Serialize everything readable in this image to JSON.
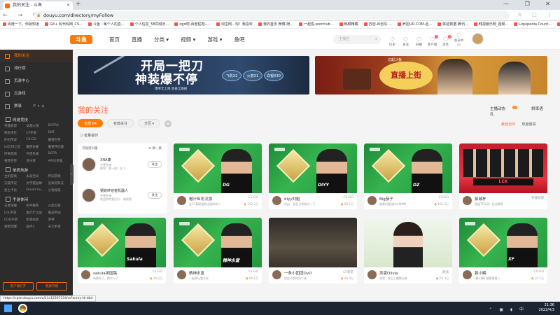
{
  "browser": {
    "tab_title": "我的关注 - 斗鱼",
    "url": "douyu.com/directory/myFollow",
    "bookmarks": [
      "百度一下，你就知道",
      "Git+ 码代码网_CS...",
      "斗鱼 - 每个人的直...",
      "个人信息_58同城手...",
      "ogd吧-百度贴吧--...",
      "淘宝网 - 淘！我喜欢",
      "我的首页 微博-随...",
      "一起看-pornhub...",
      "韩颖精确",
      "苏创-AI创写-...",
      "养招UD.COM-足...",
      "体验数据-腾讯...",
      "韩视最乐网_视频...",
      "Liquipedia Count...",
      "维强网后台"
    ]
  },
  "header": {
    "logo": "斗鱼",
    "nav": [
      "首页",
      "直播",
      "分类",
      "视频",
      "游戏",
      "鱼吧"
    ],
    "search_placeholder": "主播名",
    "tools": [
      {
        "label": "历史",
        "icon": "history-icon",
        "badge": ""
      },
      {
        "label": "关注",
        "icon": "heart-icon",
        "badge": ""
      },
      {
        "label": "开播",
        "icon": "camera-icon",
        "badge": ""
      },
      {
        "label": "客户端",
        "icon": "download-icon",
        "badge": "9"
      },
      {
        "label": "消息",
        "icon": "bell-icon",
        "badge": "6"
      },
      {
        "label": "会员中心",
        "icon": "vip-icon",
        "badge": ""
      }
    ]
  },
  "sidebar": {
    "items": [
      {
        "label": "我的关注",
        "active": true
      },
      {
        "label": "排行榜",
        "active": false
      },
      {
        "label": "页游中心",
        "active": false
      },
      {
        "label": "云游戏",
        "active": false
      }
    ],
    "icon_row": "赛事",
    "sections": [
      {
        "title": "网游竞技",
        "items": [
          "英雄联盟",
          "穿越火线",
          "DOTA2",
          "绝地求生",
          "CF手游",
          "DNF",
          "炉石传说",
          "CS:GO",
          "魔兽世界",
          "lol云顶之弈",
          "魔兽争霸",
          "魔兽怀旧服",
          "传奇游戏",
          "守望先锋",
          "DOTA",
          "重燃世界",
          "逆水寒",
          "APEX英雄"
        ]
      },
      {
        "title": "单机热游",
        "items": [
          "主机游戏",
          "永劫无间",
          "怀旧游戏",
          "天痕传说",
          "文字盟运球",
          "逃离塔科夫",
          "星之卡比",
          "Dread Hu...",
          "小程呱呱"
        ]
      },
      {
        "title": "手游休闲",
        "items": [
          "王者荣耀",
          "和平精英",
          "火影忍者",
          "LOL手游",
          "金铲铲之战",
          "重返帝国",
          "COD手游",
          "新游拟放",
          "原神",
          "黎明觉醒",
          "崩坏3",
          "天刀手游"
        ]
      }
    ],
    "btn_client": "客户端打开",
    "btn_live": "我要开播"
  },
  "banners": {
    "b1_slogan1": "开局一把刀",
    "b1_slogan2": "神装爆不停",
    "b1_sub": "爆率无上限 装备全靠刷",
    "b1_badges": [
      "飞机X2",
      "火箭X1",
      "白银X30"
    ],
    "b2_title": "直播上街",
    "b2_pretitle": "亿起斗鱼"
  },
  "follow": {
    "title": "我的关注",
    "actions": [
      {
        "label": "主播动态",
        "badge": "27"
      },
      {
        "label": "斜率语孔",
        "badge": ""
      }
    ],
    "filters": [
      {
        "label": "全部",
        "count": "64",
        "on": true
      },
      {
        "label": "有鼓关注",
        "count": "",
        "on": false
      },
      {
        "label": "分区",
        "count": "",
        "on": false
      }
    ],
    "sort_hot": "最佳访问",
    "sort_new": "热度最高",
    "batch": "批量操作"
  },
  "recommend": {
    "header": "可能感兴趣",
    "switch": "换一换",
    "items": [
      {
        "name": "XNA康",
        "desc1": "守望先锋",
        "desc2": "聊到：我一起 [ 在 ]",
        "follow": "关注"
      },
      {
        "name": "钢铁终结者机器人",
        "desc1": "守望先锋",
        "desc2": "欢迎你的我们为... 继续吧",
        "follow": "关注"
      }
    ]
  },
  "cards": [
    {
      "name": "帽汁纵冬汉强",
      "game": "CS:GO",
      "title": "全CF基础强的出现的男人",
      "views": "152.2万",
      "plate": "DG"
    },
    {
      "name": "diyy刘姐",
      "game": "CS:GO",
      "title": "diyy：钻石大家助力一下",
      "views": "60.1万",
      "plate": "DIYY"
    },
    {
      "name": "Big茄子",
      "game": "CS:GO",
      "title": "能赛对窗组tha M4f8",
      "views": "101.5万",
      "plate": "DZ"
    },
    {
      "name": "拓城杯",
      "game": "英雄联盟",
      "title": "首届TT年冠：拉法赛等",
      "views": "",
      "plate": ""
    },
    {
      "name": "sakula英国路",
      "game": "CS:GO",
      "title": "新赛车了，斯中十了",
      "views": "35.2万",
      "plate": "Sakula"
    },
    {
      "name": "精神永富",
      "game": "CS:GO",
      "title": "一起来玩看大家",
      "views": "66.1万",
      "plate": "精神永富"
    },
    {
      "name": "一条小团团OvO",
      "game": "CF射游",
      "title": "现在不是时间二来",
      "views": "83.3万",
      "plate": ""
    },
    {
      "name": "苏恩Olivia",
      "game": "颜值",
      "title": "苏恩：苏尘上播熊出来",
      "views": "65.3万",
      "plate": ""
    },
    {
      "name": "赖小鳞",
      "game": "CS:GO",
      "title": "[赖小鳞] 稳稳落到入",
      "views": "37.7万",
      "plate": "XF"
    }
  ],
  "status_url": "https://cpsn.douyu.com/u/11c12507334/ro?onmy-tk-dbd",
  "taskbar": {
    "time": "21:36",
    "date": "2022/4/3"
  }
}
